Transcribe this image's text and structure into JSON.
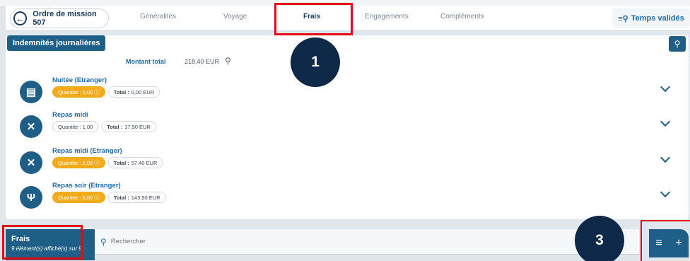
{
  "header": {
    "back_label": "Ordre de mission 507",
    "tabs": [
      {
        "label": "Généralités",
        "active": false
      },
      {
        "label": "Voyage",
        "active": false
      },
      {
        "label": "Frais",
        "active": true
      },
      {
        "label": "Engagements",
        "active": false
      },
      {
        "label": "Compléments",
        "active": false
      }
    ],
    "temps_label": "Temps validés"
  },
  "panel": {
    "title": "Indemnités journalières",
    "montant_label": "Montant total",
    "montant_value": "218,40 EUR",
    "items": [
      {
        "title": "Nuitée (Etranger)",
        "icon": "bed-icon",
        "quantite": "Quantite : 0,00 ⓘ",
        "quantite_warn": true,
        "total": "0,00 EUR"
      },
      {
        "title": "Repas midi",
        "icon": "utensils-icon",
        "quantite": "Quantite : 1,00",
        "quantite_warn": false,
        "total": "17,50 EUR"
      },
      {
        "title": "Repas midi (Etranger)",
        "icon": "utensils-icon",
        "quantite": "Quantite : 2,00 ⓘ",
        "quantite_warn": true,
        "total": "57,40 EUR"
      },
      {
        "title": "Repas soir (Etranger)",
        "icon": "fork-knife-icon",
        "quantite": "Quantite : 5,00 ⓘ",
        "quantite_warn": true,
        "total": "143,50 EUR"
      }
    ],
    "total_label": "Total :"
  },
  "bottom": {
    "title": "Frais",
    "subtitle": "9 élément(s) affiché(s) sur 9",
    "search_placeholder": "Rechercher"
  },
  "callouts": [
    "1",
    "3"
  ],
  "colors": {
    "primary": "#1f5f87",
    "accent": "#1e6aa8",
    "warning": "#f2ac1b",
    "highlight": "#e50914",
    "callout": "#0e2847"
  }
}
